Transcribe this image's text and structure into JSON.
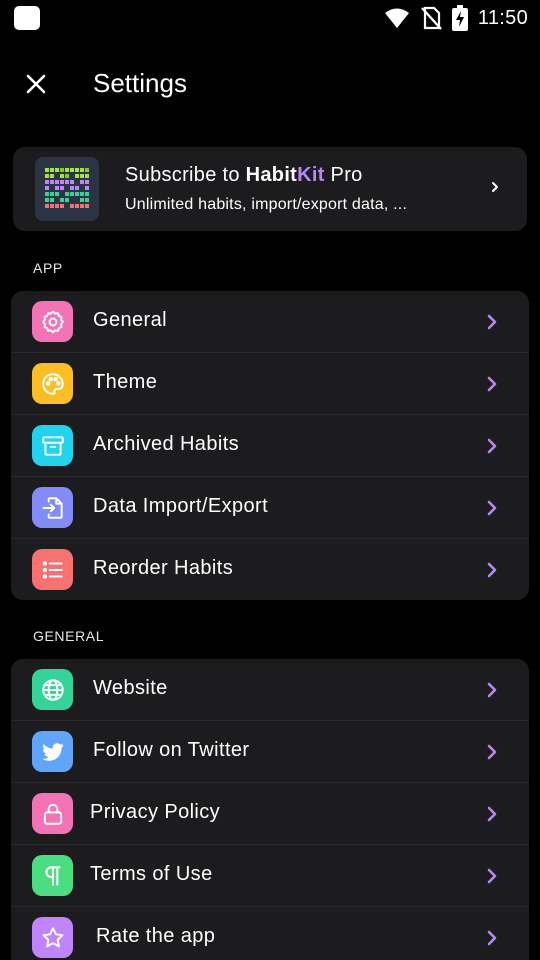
{
  "status_bar": {
    "time": "11:50"
  },
  "header": {
    "title": "Settings"
  },
  "pro_card": {
    "title_prefix": "Subscribe to ",
    "brand_habit": "Habit",
    "brand_kit": "Kit",
    "title_suffix": " Pro",
    "subtitle": "Unlimited habits, import/export data, ..."
  },
  "sections": {
    "app": {
      "label": "APP",
      "items": [
        {
          "label": "General",
          "icon": "gear-icon",
          "color": "#f472b6"
        },
        {
          "label": "Theme",
          "icon": "palette-icon",
          "color": "#fbbf24"
        },
        {
          "label": "Archived Habits",
          "icon": "archive-icon",
          "color": "#22d3ee"
        },
        {
          "label": "Data Import/Export",
          "icon": "file-import-icon",
          "color": "#818cf8"
        },
        {
          "label": "Reorder Habits",
          "icon": "list-icon",
          "color": "#f87171"
        }
      ]
    },
    "general": {
      "label": "GENERAL",
      "items": [
        {
          "label": "Website",
          "icon": "globe-icon",
          "color": "#34d399"
        },
        {
          "label": "Follow on Twitter",
          "icon": "twitter-icon",
          "color": "#60a5fa"
        },
        {
          "label": "Privacy Policy",
          "icon": "lock-icon",
          "color": "#f472b6"
        },
        {
          "label": "Terms of Use",
          "icon": "paragraph-icon",
          "color": "#4ade80"
        },
        {
          "label": "Rate the app",
          "icon": "star-icon",
          "color": "#c084fc"
        }
      ]
    }
  },
  "colors": {
    "accent_chevron": "#b489f5",
    "card_background": "#1c1c1e"
  }
}
